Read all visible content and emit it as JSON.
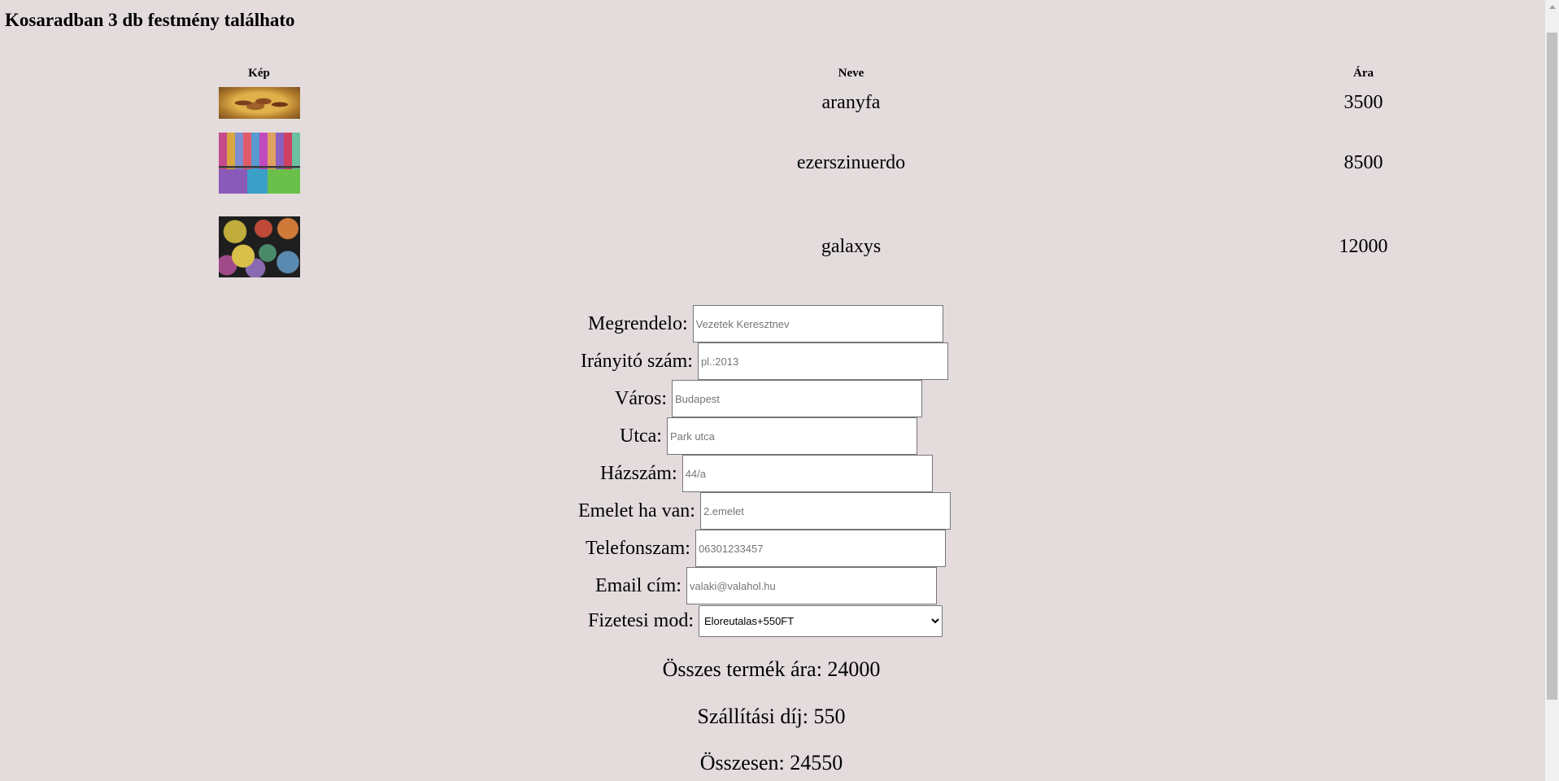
{
  "page": {
    "title": "Kosaradban 3 db festmény találhato"
  },
  "cart": {
    "headers": {
      "image": "Kép",
      "name": "Neve",
      "price": "Ára"
    },
    "items": [
      {
        "name": "aranyfa",
        "price": "3500"
      },
      {
        "name": "ezerszinuerdo",
        "price": "8500"
      },
      {
        "name": "galaxys",
        "price": "12000"
      }
    ]
  },
  "form": {
    "customer": {
      "label": "Megrendelo:",
      "placeholder": "Vezetek Keresztnev"
    },
    "zip": {
      "label": "Irányitó szám:",
      "placeholder": "pl.:2013"
    },
    "city": {
      "label": "Város:",
      "placeholder": "Budapest"
    },
    "street": {
      "label": "Utca:",
      "placeholder": "Park utca"
    },
    "house_number": {
      "label": "Házszám:",
      "placeholder": "44/a"
    },
    "floor": {
      "label": "Emelet ha van:",
      "placeholder": "2.emelet"
    },
    "phone": {
      "label": "Telefonszam:",
      "placeholder": "06301233457"
    },
    "email": {
      "label": "Email cím:",
      "placeholder": "valaki@valahol.hu"
    },
    "payment": {
      "label": "Fizetesi mod:",
      "selected": "Eloreutalas+550FT"
    }
  },
  "summary": {
    "products_total": "Összes termék ára: 24000",
    "shipping": "Szállítási díj: 550",
    "grand_total": "Összesen: 24550"
  }
}
